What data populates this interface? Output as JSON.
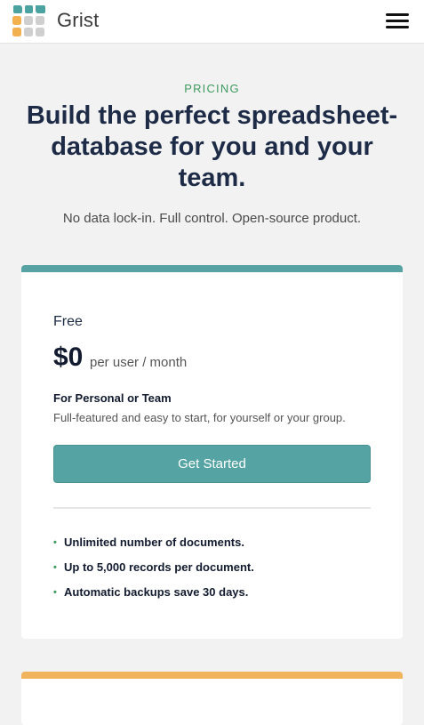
{
  "header": {
    "logo_text": "Grist",
    "menu_icon": "hamburger-menu-icon"
  },
  "hero": {
    "eyebrow": "PRICING",
    "headline_lines": [
      "Build the perfect spreadsheet-",
      "database for you and your",
      "team."
    ],
    "subhead": "No data lock-in. Full control. Open-source product."
  },
  "plans": [
    {
      "name": "Free",
      "price": "$0",
      "price_unit": "per user / month",
      "audience": "For Personal or Team",
      "description": "Full-featured and easy to start, for yourself or your group.",
      "cta_label": "Get Started",
      "features": [
        "Unlimited number of documents.",
        "Up to 5,000 records per document.",
        "Automatic backups save 30 days."
      ],
      "accent_color": "#57a3a3"
    },
    {
      "accent_color": "#f0b45c"
    }
  ],
  "colors": {
    "background": "#f2f2f2",
    "eyebrow": "#3e9a5f",
    "headline": "#1d2b46",
    "button": "#55a3a3",
    "logo_teal": "#4aa3a1",
    "logo_orange": "#f2b14e",
    "logo_gray": "#cfcfcf"
  }
}
